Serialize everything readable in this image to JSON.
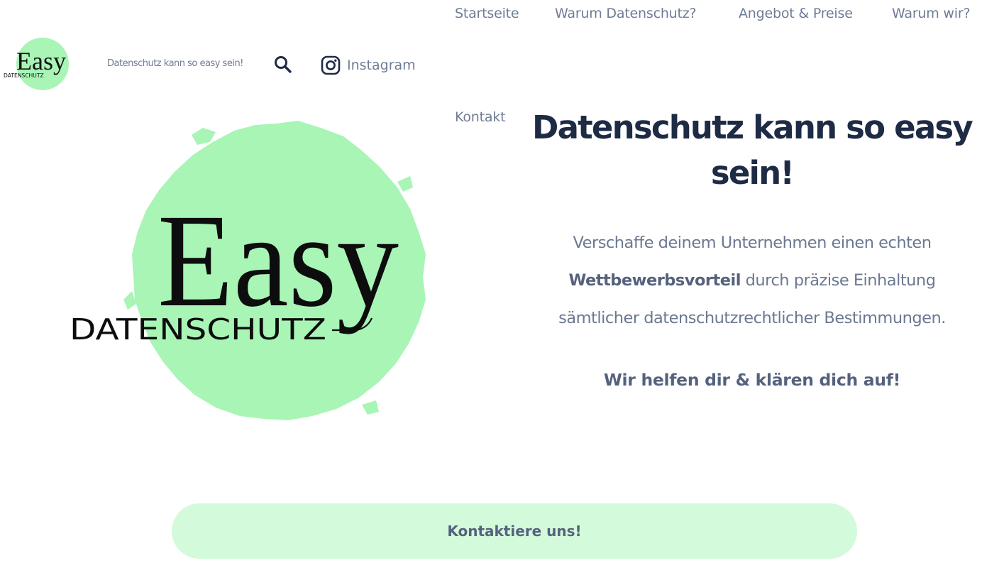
{
  "nav": {
    "items": [
      {
        "label": "Startseite"
      },
      {
        "label": "Warum Datenschutz?"
      },
      {
        "label": "Angebot & Preise"
      },
      {
        "label": "Warum wir?"
      },
      {
        "label": "Kontakt"
      }
    ]
  },
  "header": {
    "logo": {
      "wordmark": "Easy",
      "subtitle": "DATENSCHUTZ"
    },
    "tagline": "Datenschutz kann so easy sein!",
    "search_icon": "search-icon",
    "instagram": {
      "icon": "instagram-icon",
      "label": "Instagram"
    }
  },
  "hero_logo": {
    "wordmark": "Easy",
    "subtitle": "DATENSCHUTZ"
  },
  "hero": {
    "title": "Datenschutz kann so easy sein!",
    "description": {
      "part1": "Verschaffe deinem Unternehmen einen echten",
      "highlight": "Wettbewerbsvorteil",
      "part2": "durch präzise Einhaltung sämtlicher datenschutzrechtlicher Bestimmungen."
    },
    "cta_text": "Wir helfen dir & klären dich auf!"
  },
  "contact_button": {
    "label": "Kontaktiere uns!"
  },
  "colors": {
    "brand_green": "#a8f5b6",
    "button_green": "#d3fadb",
    "heading": "#1e2b45",
    "text": "#6b7891"
  }
}
